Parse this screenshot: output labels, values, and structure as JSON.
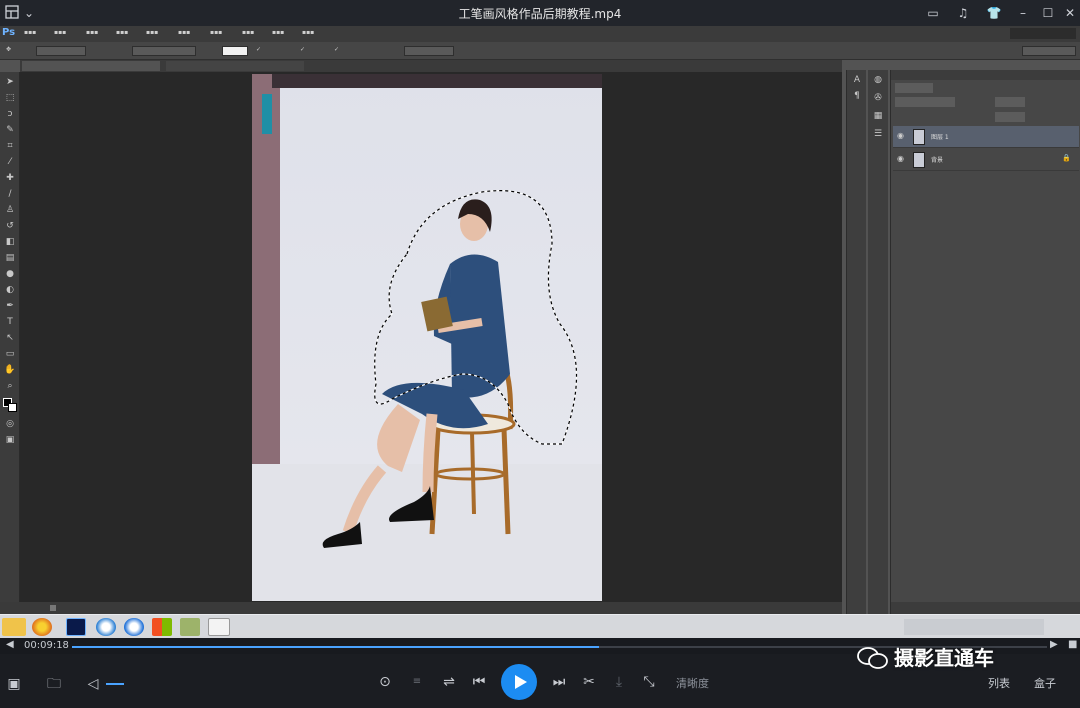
{
  "window": {
    "title": "工笔画风格作品后期教程.mp4"
  },
  "ps": {
    "logo": "Ps",
    "layers": [
      "图层 1",
      "背景"
    ]
  },
  "player": {
    "time": "00:09:18",
    "progress": 0.54,
    "buttons": {
      "clarity": "清晰度",
      "list": "列表",
      "box": "盒子"
    }
  },
  "watermark": "摄影直通车",
  "colors": {
    "accent": "#1c8cf2",
    "progress": "#4aa3ff"
  }
}
